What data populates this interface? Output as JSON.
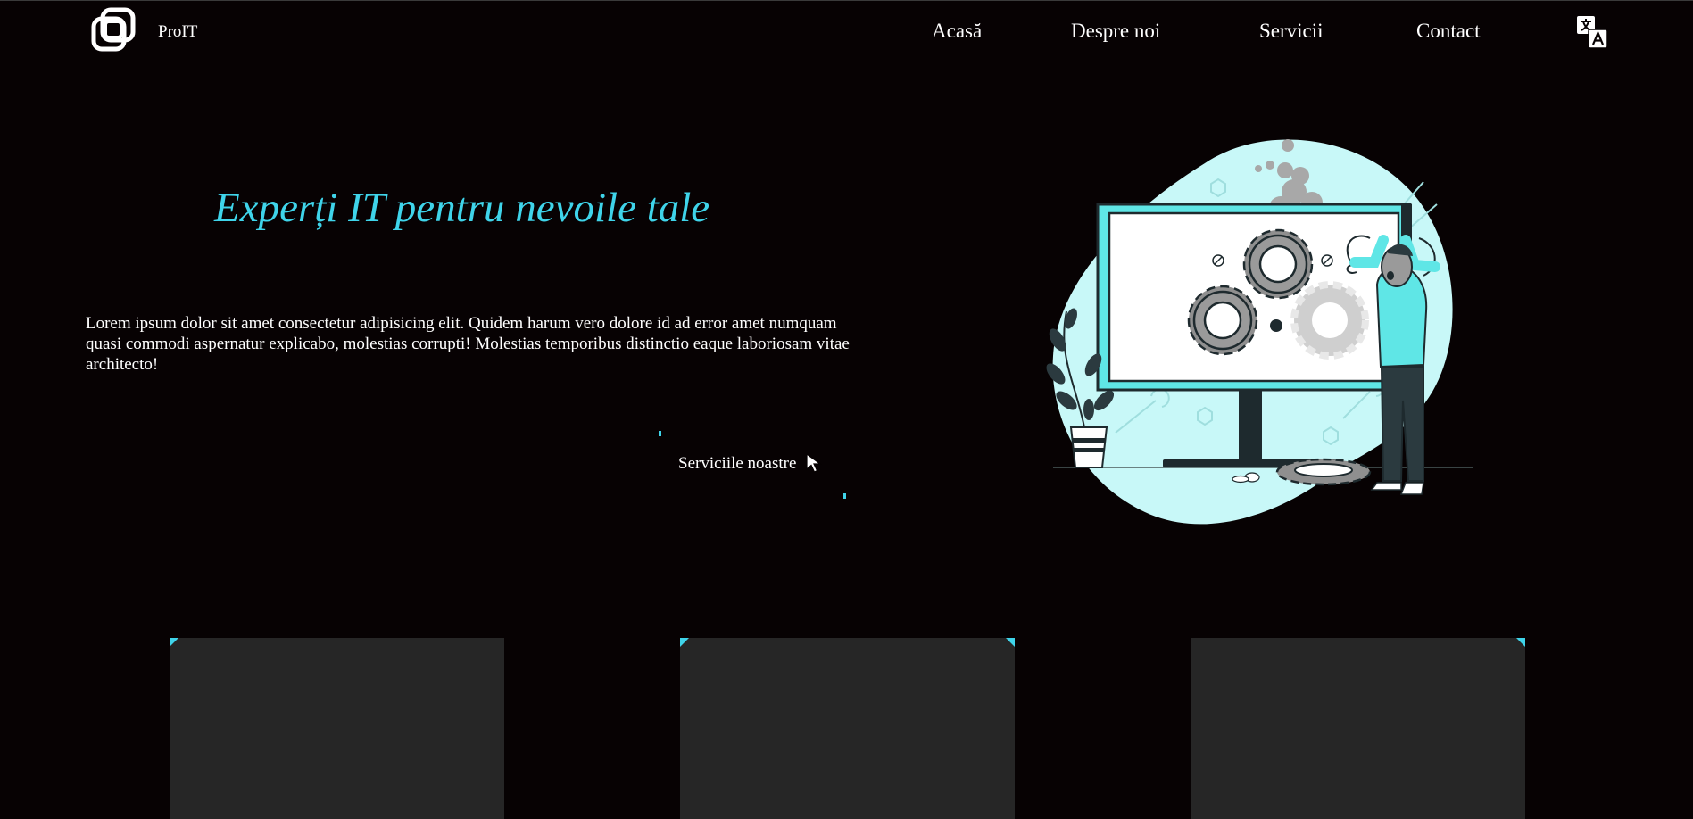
{
  "header": {
    "brand": "ProIT",
    "nav": {
      "home": "Acasă",
      "about": "Despre noi",
      "services": "Servicii",
      "contact": "Contact"
    }
  },
  "hero": {
    "title": "Experți IT pentru nevoile tale",
    "text": "Lorem ipsum dolor sit amet consectetur adipisicing elit. Quidem harum vero dolore id ad error amet numquam quasi commodi aspernatur explicabo, molestias corrupti! Molestias temporibus distinctio eaque laboriosam vitae architecto!",
    "cta_label": "Serviciile noastre"
  },
  "theme": {
    "background": "#070203",
    "accent": "#3fd4ea",
    "card_background": "#262626",
    "illustration_blob": "#c8f8f8"
  },
  "icons": {
    "logo": "logo-icon",
    "language": "translate-icon",
    "cursor": "pointer-cursor-icon"
  }
}
